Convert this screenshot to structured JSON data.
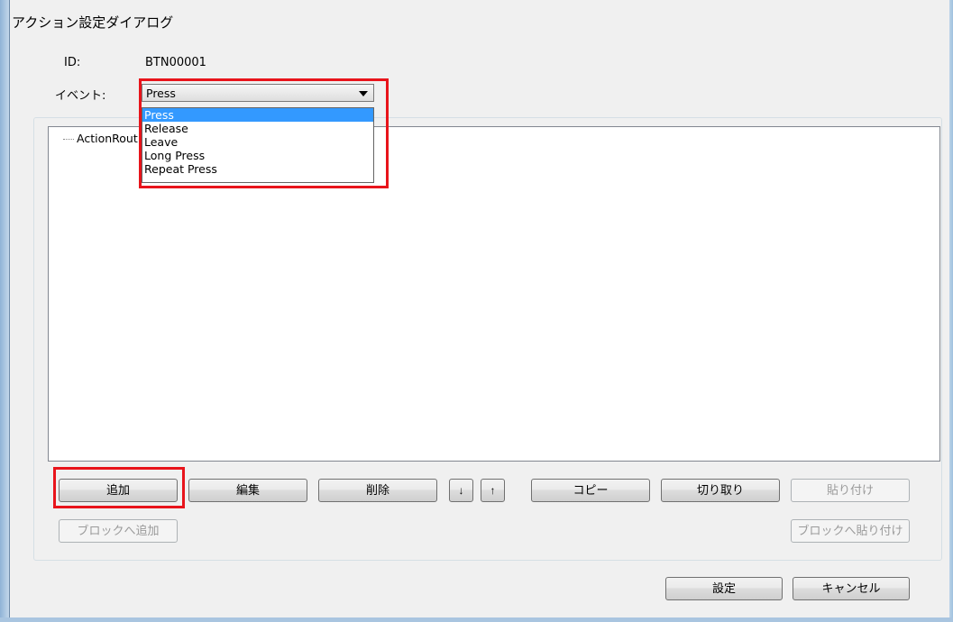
{
  "window": {
    "title": "アクション設定ダイアログ"
  },
  "fields": {
    "id_label": "ID:",
    "id_value": "BTN00001",
    "event_label": "イベント:",
    "event_selected": "Press"
  },
  "dropdown": {
    "options": [
      "Press",
      "Release",
      "Leave",
      "Long Press",
      "Repeat Press"
    ],
    "selected_index": 0
  },
  "tree": {
    "root_label": "ActionRout"
  },
  "actions": {
    "add": "追加",
    "edit": "編集",
    "delete": "削除",
    "move_down_icon": "↓",
    "move_up_icon": "↑",
    "copy": "コピー",
    "cut": "切り取り",
    "paste": "貼り付け",
    "add_to_block": "ブロックへ追加",
    "paste_to_block": "ブロックへ貼り付け"
  },
  "footer": {
    "ok": "設定",
    "cancel": "キャンセル"
  },
  "colors": {
    "highlight": "#e8141b",
    "selection": "#3399ff"
  }
}
